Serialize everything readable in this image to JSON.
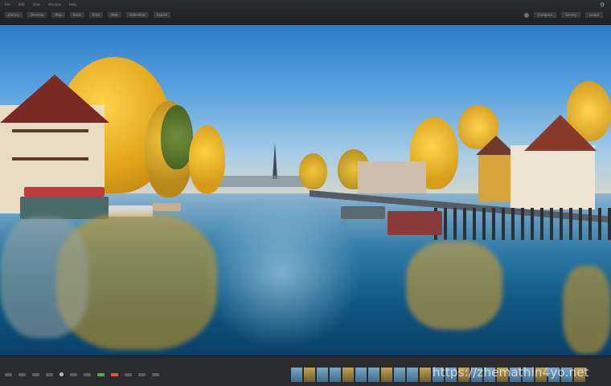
{
  "toolbar": {
    "top_labels": [
      "File",
      "Edit",
      "View",
      "Window",
      "Help"
    ],
    "menus": [
      "Library",
      "Develop",
      "Map",
      "Book",
      "Print",
      "Web",
      "Slideshow",
      "Export"
    ],
    "right_menus": [
      "Compare",
      "Survey",
      "Loupe"
    ]
  },
  "watermark": "https://zhemathin4yo.net",
  "filmstrip": {
    "thumb_count": 23
  }
}
